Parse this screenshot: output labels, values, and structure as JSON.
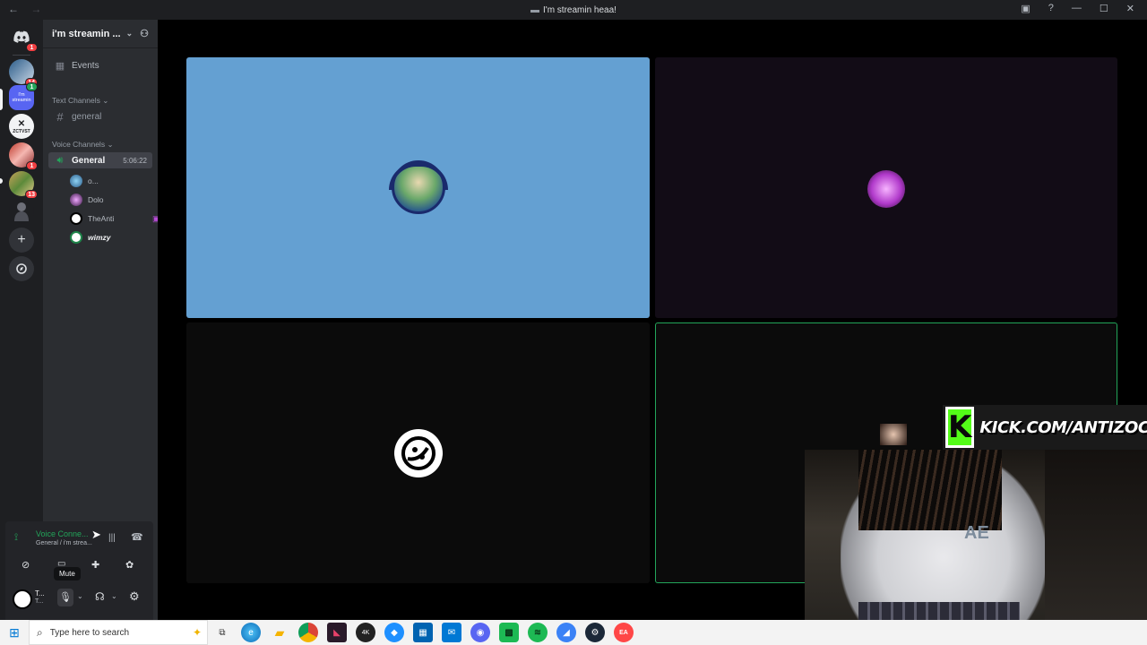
{
  "window": {
    "title": "I'm streamin heaa!"
  },
  "server": {
    "name": "i'm streamin ...",
    "servers": [
      {
        "icon": "discord-home-icon",
        "badge": "1"
      },
      {
        "icon": "server-1",
        "badge": "14"
      },
      {
        "icon": "server-selected",
        "badge": "1"
      },
      {
        "icon": "server-3",
        "badge": ""
      },
      {
        "icon": "server-4",
        "badge": "1"
      },
      {
        "icon": "server-5",
        "badge": "13"
      },
      {
        "icon": "server-6",
        "badge": ""
      }
    ],
    "server3_label": "ZCTVST",
    "selected_label": "I'm streamin"
  },
  "channels": {
    "events_label": "Events",
    "text_category": "Text Channels",
    "text_channel": "general",
    "voice_category": "Voice Channels",
    "voice_channel": "General",
    "voice_timer": "5:06:22",
    "users": [
      {
        "name": "o...",
        "color": "#3e8ed0"
      },
      {
        "name": "Dolo",
        "color": "#9b59b6"
      },
      {
        "name": "TheAnti",
        "color": "#ffffff"
      },
      {
        "name": "wimzy",
        "color": "#2ecc71"
      }
    ]
  },
  "voice_panel": {
    "status": "Voice Conne...",
    "subtitle": "General / i'm strea...",
    "tooltip": "Mute",
    "user_short": "T...",
    "user_sub": "T..."
  },
  "stream": {
    "tiles": [
      {
        "bg": "#64a0d2",
        "kind": "avatar-headphones"
      },
      {
        "bg": "#120c16",
        "kind": "avatar-pink"
      },
      {
        "bg": "#0b0b0b",
        "kind": "avatar-logo"
      },
      {
        "bg": "#0b0b0b",
        "kind": "speaking",
        "border": "#23a55a"
      }
    ]
  },
  "overlay": {
    "kick_text": "KICK.COM/ANTIZOC",
    "shirt_text": "AE"
  },
  "taskbar": {
    "search_placeholder": "Type here to search"
  },
  "colors": {
    "green": "#23a55a",
    "blurple": "#5865f2",
    "red": "#f23f42"
  }
}
